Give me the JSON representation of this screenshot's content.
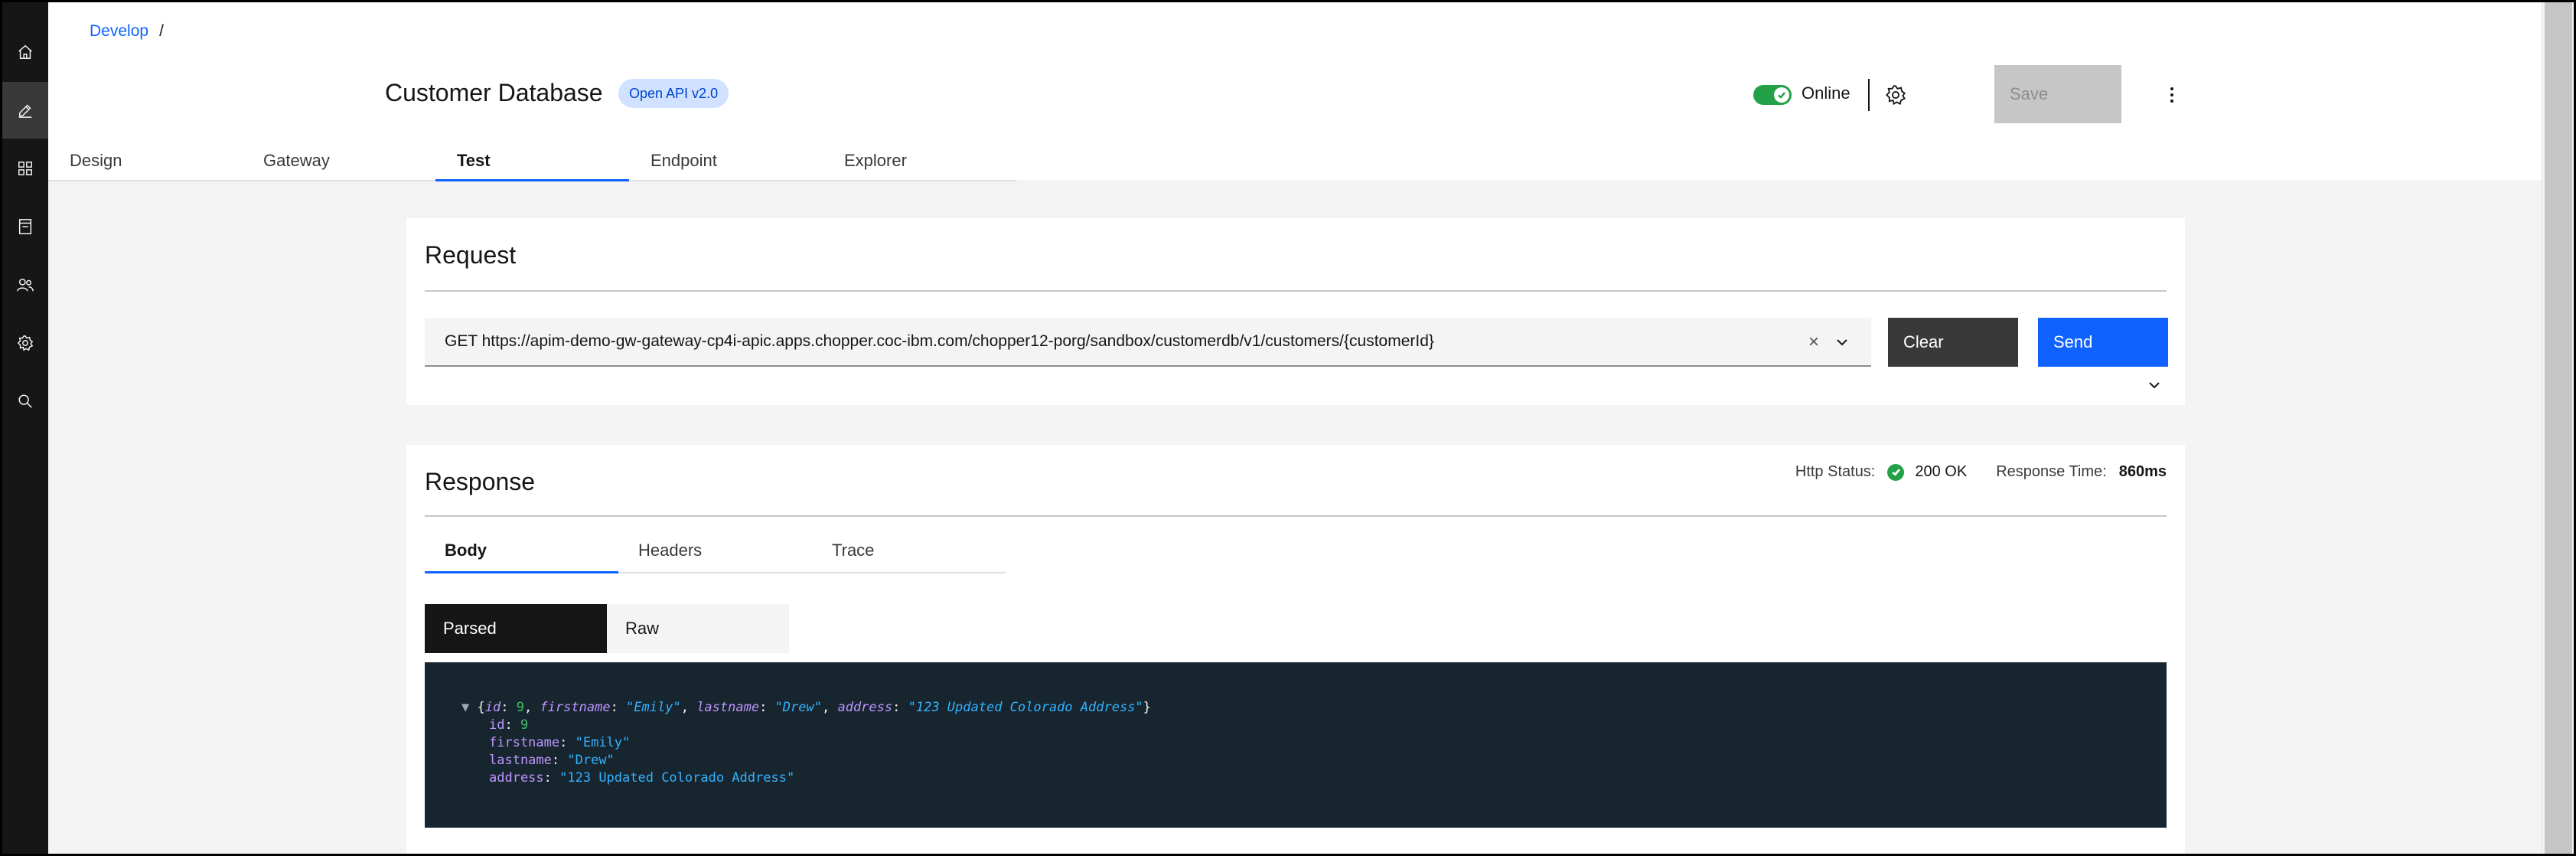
{
  "rail": {
    "items": [
      {
        "icon": "home-icon"
      },
      {
        "icon": "edit-icon",
        "active": true
      },
      {
        "icon": "apps-icon"
      },
      {
        "icon": "catalog-icon"
      },
      {
        "icon": "users-icon"
      },
      {
        "icon": "settings-icon"
      },
      {
        "icon": "search-icon"
      }
    ]
  },
  "header": {
    "breadcrumb": {
      "link": "Develop",
      "separator": "/"
    },
    "title": "Customer Database",
    "badge": "Open API v2.0",
    "status_label": "Online",
    "save_label": "Save",
    "tabs": [
      "Design",
      "Gateway",
      "Test",
      "Endpoint",
      "Explorer"
    ],
    "selected_tab": "Test"
  },
  "request": {
    "heading": "Request",
    "url": "GET https://apim-demo-gw-gateway-cp4i-apic.apps.chopper.coc-ibm.com/chopper12-porg/sandbox/customerdb/v1/customers/{customerId}",
    "clear_symbol": "×",
    "clear_label": "Clear",
    "send_label": "Send"
  },
  "response": {
    "heading": "Response",
    "http_status_label": "Http Status:",
    "http_status_value": "200 OK",
    "response_time_label": "Response Time:",
    "response_time_value": "860ms",
    "tabs": [
      "Body",
      "Headers",
      "Trace"
    ],
    "selected_tab": "Body",
    "views": [
      "Parsed",
      "Raw"
    ],
    "selected_view": "Parsed",
    "body": {
      "toggle": "▼",
      "summary": {
        "id": "9",
        "firstname": "\"Emily\"",
        "lastname": "\"Drew\"",
        "address": "\"123 Updated Colorado Address\""
      },
      "fields": [
        {
          "key": "id",
          "value": "9",
          "type": "number"
        },
        {
          "key": "firstname",
          "value": "\"Emily\"",
          "type": "string"
        },
        {
          "key": "lastname",
          "value": "\"Drew\"",
          "type": "string"
        },
        {
          "key": "address",
          "value": "\"123 Updated Colorado Address\"",
          "type": "string"
        }
      ]
    }
  },
  "colors": {
    "accent": "#0f62fe",
    "success": "#24a148",
    "rail": "#161616",
    "code_background": "#17252f"
  }
}
